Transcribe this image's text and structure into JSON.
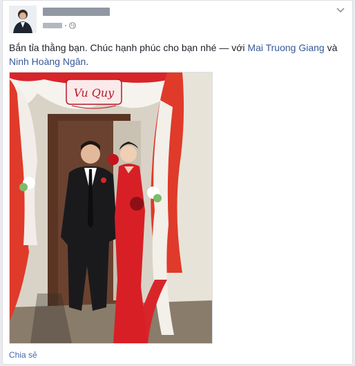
{
  "post": {
    "author_name": "",
    "status_text_before": "Bắn tỉa thằng bạn. Chúc hạnh phúc cho bạn nhé — với ",
    "tagged_1": "Mai Truong Giang",
    "conjunction": " và ",
    "tagged_2": "Ninh Hoàng Ngân",
    "period": ".",
    "photo_sign_text": "Vu Quy",
    "share_label": "Chia sẻ",
    "privacy_icon": "globe-icon",
    "menu_icon": "chevron-down-icon"
  },
  "colors": {
    "link": "#365899",
    "share_link": "#4267b2",
    "drape_red": "#e03a2a",
    "dress_red": "#d81f26"
  }
}
